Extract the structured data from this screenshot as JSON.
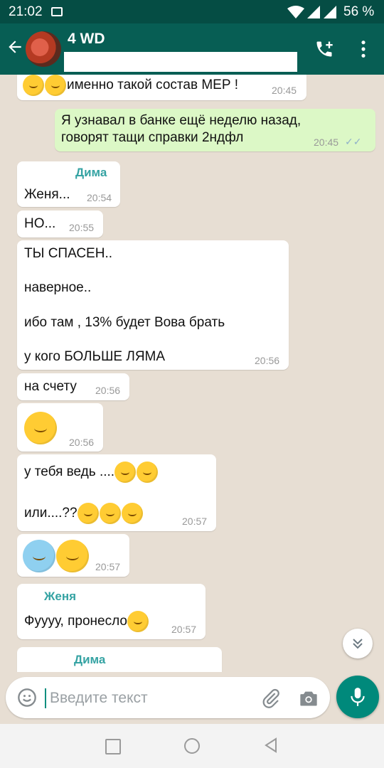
{
  "status_bar": {
    "time": "21:02",
    "battery": "56 %"
  },
  "header": {
    "title": "4 WD"
  },
  "messages": [
    {
      "text": "именно такой состав МЕР !",
      "time": "20:45"
    },
    {
      "line1": "Я узнавал в банке ещё неделю назад,",
      "line2": "говорят тащи справки 2ндфл",
      "time": "20:45",
      "ticks": "✓✓"
    },
    {
      "sender": "Дима",
      "text": "Женя...",
      "time": "20:54"
    },
    {
      "text": "НО...",
      "time": "20:55"
    },
    {
      "line1": "ТЫ СПАСЕН..",
      "line2": "наверное..",
      "line3": "ибо там , 13% будет Вова брать",
      "line4": "у кого БОЛЬШЕ ЛЯМА",
      "time": "20:56"
    },
    {
      "text": "на счету",
      "time": "20:56"
    },
    {
      "time": "20:56"
    },
    {
      "line1": "у тебя ведь  ....",
      "line2": "или....??",
      "time": "20:57"
    },
    {
      "time": "20:57"
    },
    {
      "sender": "Женя",
      "text": "Фуууу, пронесло",
      "time": "20:57"
    },
    {
      "sender": "Дима"
    }
  ],
  "input": {
    "placeholder": "Введите текст"
  },
  "colors": {
    "header": "#075e54",
    "status_bar": "#054d44",
    "outgoing_bubble": "#dcf8c6",
    "accent": "#00897b"
  }
}
